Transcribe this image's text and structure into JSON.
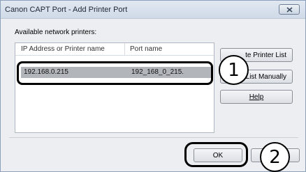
{
  "window": {
    "title": "Canon CAPT Port - Add Printer Port"
  },
  "list": {
    "label": "Available network printers:",
    "columns": [
      "IP Address or Printer name",
      "Port name"
    ],
    "rows": [
      {
        "ip": "192.168.0.215",
        "port": "192_168_0_215."
      }
    ]
  },
  "buttons": {
    "update": "te Printer List",
    "manual": "List Manually",
    "help": "Help",
    "ok": "OK",
    "cancel": ""
  },
  "callouts": {
    "one": "1",
    "two": "2"
  }
}
